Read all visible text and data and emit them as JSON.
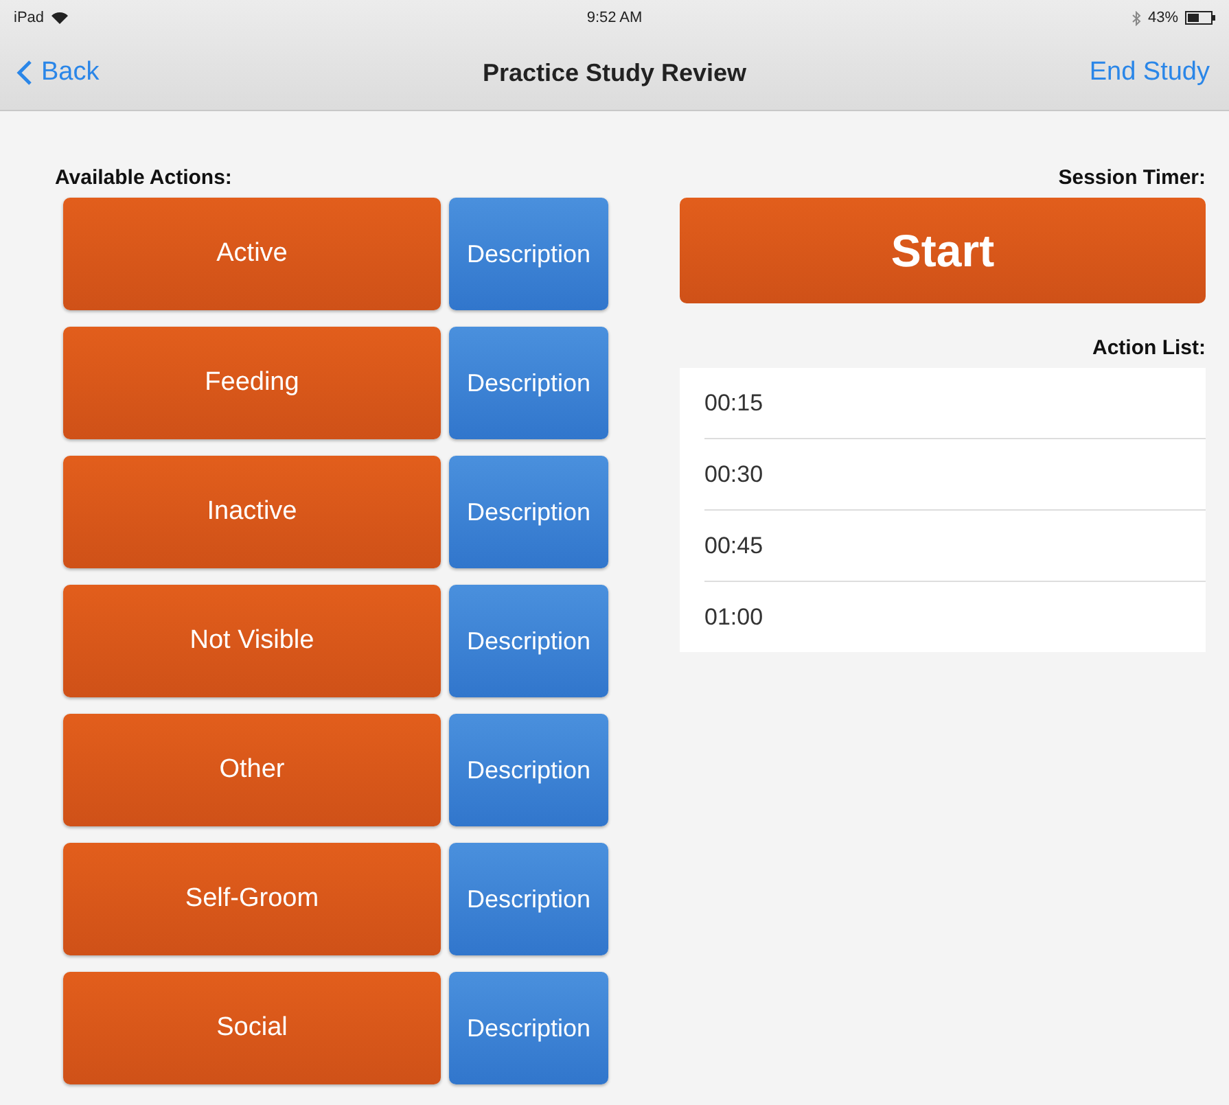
{
  "status_bar": {
    "device": "iPad",
    "time": "9:52 AM",
    "battery": "43%"
  },
  "nav_bar": {
    "back": "Back",
    "title": "Practice Study Review",
    "action": "End Study"
  },
  "actions": {
    "heading": "Available Actions:",
    "items": [
      {
        "label": "Active",
        "description": "Description"
      },
      {
        "label": "Feeding",
        "description": "Description"
      },
      {
        "label": "Inactive",
        "description": "Description"
      },
      {
        "label": "Not Visible",
        "description": "Description"
      },
      {
        "label": "Other",
        "description": "Description"
      },
      {
        "label": "Self-Groom",
        "description": "Description"
      },
      {
        "label": "Social",
        "description": "Description"
      }
    ]
  },
  "timer": {
    "heading": "Session Timer:",
    "button": "Start"
  },
  "action_list": {
    "heading": "Action List:",
    "items": [
      "00:15",
      "00:30",
      "00:45",
      "01:00"
    ]
  }
}
